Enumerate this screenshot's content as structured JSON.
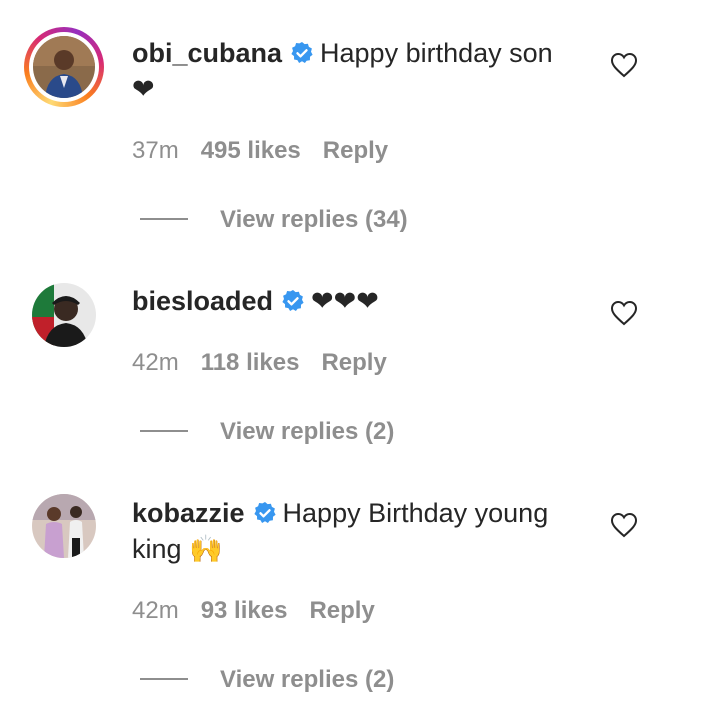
{
  "comments": [
    {
      "username": "obi_cubana",
      "text": "Happy birthday son ❤",
      "time": "37m",
      "likes": "495 likes",
      "reply_label": "Reply",
      "view_replies": "View replies (34)",
      "avatar_story_ring": true
    },
    {
      "username": "biesloaded",
      "text": "❤❤❤",
      "time": "42m",
      "likes": "118 likes",
      "reply_label": "Reply",
      "view_replies": "View replies (2)",
      "avatar_story_ring": false
    },
    {
      "username": "kobazzie",
      "text": "Happy Birthday young king 🙌",
      "time": "42m",
      "likes": "93 likes",
      "reply_label": "Reply",
      "view_replies": "View replies (2)",
      "avatar_story_ring": false
    }
  ],
  "icons": {
    "verified": "verified-badge-icon",
    "like": "heart-outline-icon"
  },
  "colors": {
    "verified_blue": "#3897f0",
    "muted_text": "#8e8e8e",
    "primary_text": "#262626"
  }
}
